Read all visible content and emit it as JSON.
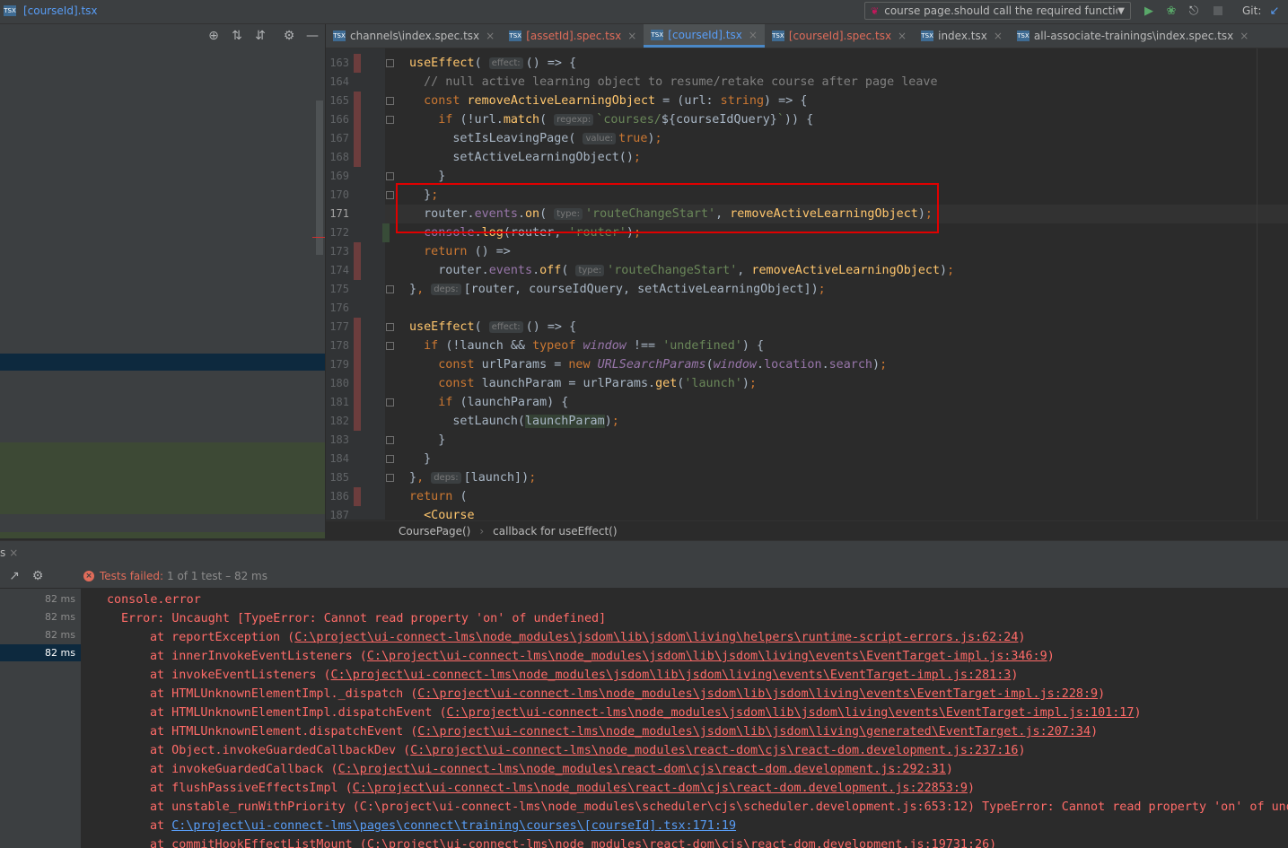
{
  "window": {
    "file_title": "[courseId].tsx"
  },
  "run_config": {
    "label": "course page.should call the required functions"
  },
  "vcs": {
    "label": "Git:"
  },
  "icons": {
    "file": "tsx-file-icon",
    "locate": "crosshair-icon",
    "expand": "expand-all-icon",
    "collapse": "collapse-all-icon",
    "settings": "gear-icon",
    "hide": "minimize-icon",
    "run": "play-icon",
    "debug": "bug-icon",
    "coverage": "coverage-icon",
    "stop": "stop-icon"
  },
  "tabs": [
    {
      "label": "channels\\index.spec.tsx",
      "state": "normal"
    },
    {
      "label": "[assetId].spec.tsx",
      "state": "error"
    },
    {
      "label": "[courseId].tsx",
      "state": "active"
    },
    {
      "label": "[courseId].spec.tsx",
      "state": "error"
    },
    {
      "label": "index.tsx",
      "state": "normal"
    },
    {
      "label": "all-associate-trainings\\index.spec.tsx",
      "state": "normal"
    }
  ],
  "editor": {
    "current_line": 171,
    "line_numbers": [
      "163",
      "164",
      "165",
      "166",
      "167",
      "168",
      "169",
      "170",
      "171",
      "172",
      "173",
      "174",
      "175",
      "176",
      "177",
      "178",
      "179",
      "180",
      "181",
      "182",
      "183",
      "184",
      "185",
      "186",
      "187"
    ],
    "hints": {
      "effect": "effect:",
      "regexp": "regexp:",
      "value": "value:",
      "type": "type:",
      "deps": "deps:"
    }
  },
  "breadcrumb": {
    "items": [
      "CoursePage()",
      "callback for useEffect()"
    ]
  },
  "run_panel": {
    "tab_label": "s",
    "status": {
      "failed_label": "Tests failed:",
      "detail": "1 of 1 test – 82 ms"
    },
    "test_times": [
      "82 ms",
      "82 ms",
      "82 ms",
      "82 ms"
    ],
    "console": [
      {
        "prefix": "console.error",
        "link": "",
        "suffix": "",
        "indent": 28
      },
      {
        "prefix": "Error: Uncaught [TypeError: Cannot read property 'on' of undefined]",
        "link": "",
        "suffix": "",
        "indent": 44
      },
      {
        "prefix": "at reportException (",
        "link": "C:\\project\\ui-connect-lms\\node_modules\\jsdom\\lib\\jsdom\\living\\helpers\\runtime-script-errors.js:62:24",
        "suffix": ")",
        "indent": 76
      },
      {
        "prefix": "at innerInvokeEventListeners (",
        "link": "C:\\project\\ui-connect-lms\\node_modules\\jsdom\\lib\\jsdom\\living\\events\\EventTarget-impl.js:346:9",
        "suffix": ")",
        "indent": 76
      },
      {
        "prefix": "at invokeEventListeners (",
        "link": "C:\\project\\ui-connect-lms\\node_modules\\jsdom\\lib\\jsdom\\living\\events\\EventTarget-impl.js:281:3",
        "suffix": ")",
        "indent": 76
      },
      {
        "prefix": "at HTMLUnknownElementImpl._dispatch (",
        "link": "C:\\project\\ui-connect-lms\\node_modules\\jsdom\\lib\\jsdom\\living\\events\\EventTarget-impl.js:228:9",
        "suffix": ")",
        "indent": 76
      },
      {
        "prefix": "at HTMLUnknownElementImpl.dispatchEvent (",
        "link": "C:\\project\\ui-connect-lms\\node_modules\\jsdom\\lib\\jsdom\\living\\events\\EventTarget-impl.js:101:17",
        "suffix": ")",
        "indent": 76
      },
      {
        "prefix": "at HTMLUnknownElement.dispatchEvent (",
        "link": "C:\\project\\ui-connect-lms\\node_modules\\jsdom\\lib\\jsdom\\living\\generated\\EventTarget.js:207:34",
        "suffix": ")",
        "indent": 76
      },
      {
        "prefix": "at Object.invokeGuardedCallbackDev (",
        "link": "C:\\project\\ui-connect-lms\\node_modules\\react-dom\\cjs\\react-dom.development.js:237:16",
        "suffix": ")",
        "indent": 76
      },
      {
        "prefix": "at invokeGuardedCallback (",
        "link": "C:\\project\\ui-connect-lms\\node_modules\\react-dom\\cjs\\react-dom.development.js:292:31",
        "suffix": ")",
        "indent": 76
      },
      {
        "prefix": "at flushPassiveEffectsImpl (",
        "link": "C:\\project\\ui-connect-lms\\node_modules\\react-dom\\cjs\\react-dom.development.js:22853:9",
        "suffix": ")",
        "indent": 76
      },
      {
        "prefix": "at unstable_runWithPriority (C:\\project\\ui-connect-lms\\node_modules\\scheduler\\cjs\\scheduler.development.js:653:12) TypeError: Cannot read property 'on' of unde",
        "link": "",
        "suffix": "",
        "indent": 76
      },
      {
        "prefix": "at ",
        "link_blue": "C:\\project\\ui-connect-lms\\pages\\connect\\training\\courses\\[courseId].tsx:171:19",
        "suffix": "",
        "indent": 76
      },
      {
        "prefix": "at commitHookEffectListMount (C:\\project\\ui-connect-lms\\node_modules\\react-dom\\cjs\\react-dom.development.js:19731:26)",
        "link": "",
        "suffix": "",
        "indent": 76
      }
    ]
  },
  "colors": {
    "error": "#ff6b68",
    "accent": "#589df6",
    "highlight_box": "#e00000"
  }
}
